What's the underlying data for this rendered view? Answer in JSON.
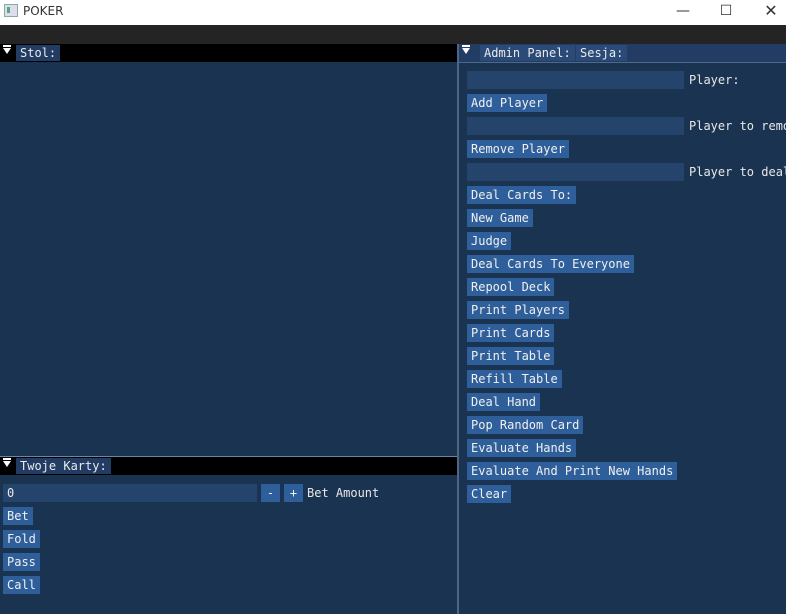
{
  "app": {
    "title": "POKER"
  },
  "window_controls": {
    "minimize": "—",
    "maximize": "☐",
    "close": "✕"
  },
  "stol": {
    "title": "Stol:"
  },
  "karty": {
    "title": "Twoje Karty:",
    "bet_value": "0",
    "minus_label": "-",
    "plus_label": "+",
    "bet_label": "Bet Amount",
    "buttons": {
      "bet": "Bet",
      "fold": "Fold",
      "pass": "Pass",
      "call": "Call"
    }
  },
  "admin": {
    "title": "Admin Panel:",
    "session_tab": "Sesja:",
    "player_label": "Player:",
    "add_player": "Add Player",
    "remove_label": "Player to remo",
    "remove_player": "Remove Player",
    "deal_label": "Player to deal",
    "deal_cards_to": "Deal Cards To:",
    "new_game": "New Game",
    "judge": "Judge",
    "deal_everyone": "Deal Cards To Everyone",
    "repool_deck": "Repool Deck",
    "print_players": "Print Players",
    "print_cards": "Print Cards",
    "print_table": "Print Table",
    "refill_table": "Refill Table",
    "deal_hand": "Deal Hand",
    "pop_random": "Pop Random Card",
    "evaluate_hands": "Evaluate Hands",
    "evaluate_print": "Evaluate And Print New Hands",
    "clear": "Clear"
  },
  "colors": {
    "window_bg": "#1a3350",
    "button": "#2f5f9a",
    "input": "#25446b",
    "header_inactive": "#000000",
    "header_active": "#233c64"
  }
}
